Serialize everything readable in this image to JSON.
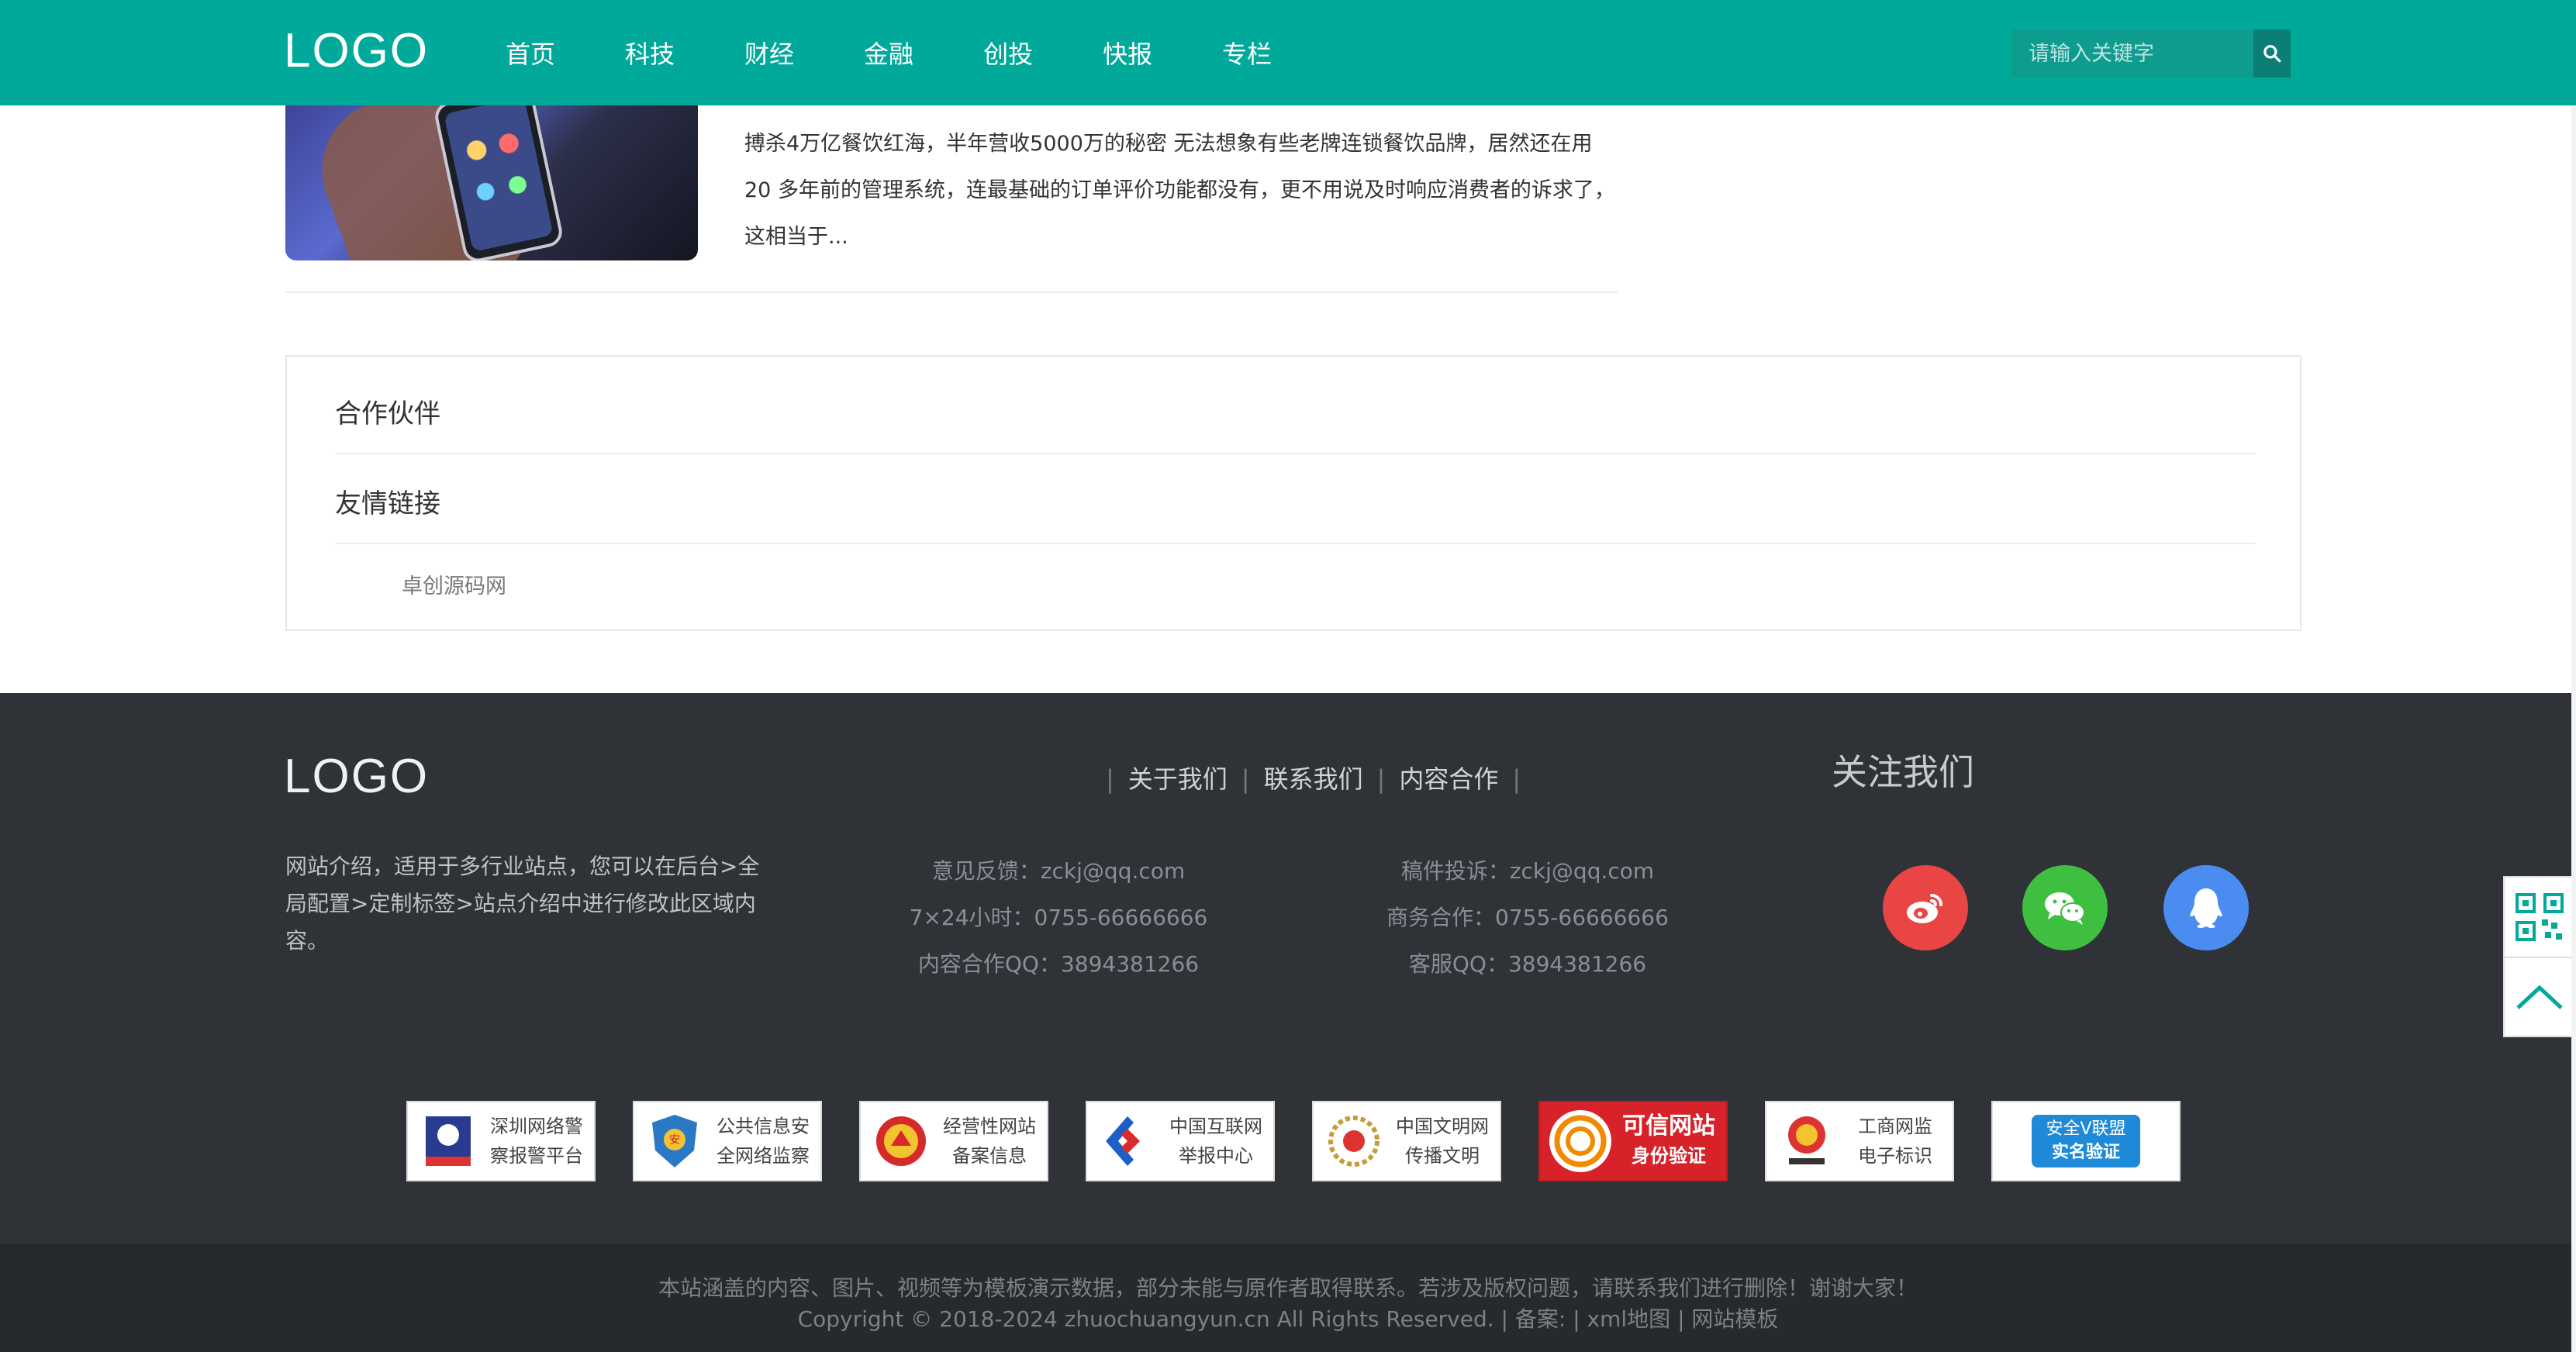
{
  "header": {
    "logo": "LOGO",
    "nav": [
      "首页",
      "科技",
      "财经",
      "金融",
      "创投",
      "快报",
      "专栏"
    ],
    "search_placeholder": "请输入关键字"
  },
  "article": {
    "excerpt": "搏杀4万亿餐饮红海，半年营收5000万的秘密 无法想象有些老牌连锁餐饮品牌，居然还在用20 多年前的管理系统，连最基础的订单评价功能都没有，更不用说及时响应消费者的诉求了，这相当于..."
  },
  "partners": {
    "title": "合作伙伴",
    "links_title": "友情链接",
    "links": [
      "卓创源码网"
    ]
  },
  "footer": {
    "logo": "LOGO",
    "intro": "网站介绍，适用于多行业站点，您可以在后台>全局配置>定制标签>站点介绍中进行修改此区域内容。",
    "links": [
      "关于我们",
      "联系我们",
      "内容合作"
    ],
    "contact_left": [
      "意见反馈：zckj@qq.com",
      "7×24小时：0755-66666666",
      "内容合作QQ：3894381266"
    ],
    "contact_right": [
      "稿件投诉：zckj@qq.com",
      "商务合作：0755-66666666",
      "客服QQ：3894381266"
    ],
    "follow_title": "关注我们",
    "social": [
      {
        "name": "weibo-icon",
        "color": "#e94545"
      },
      {
        "name": "wechat-icon",
        "color": "#3fbf3f"
      },
      {
        "name": "qq-icon",
        "color": "#4a8cf0"
      }
    ],
    "badges": [
      {
        "line1": "深圳网络警",
        "line2": "察报警平台"
      },
      {
        "line1": "公共信息安",
        "line2": "全网络监察"
      },
      {
        "line1": "经营性网站",
        "line2": "备案信息"
      },
      {
        "line1": "中国互联网",
        "line2": "举报中心"
      },
      {
        "line1": "中国文明网",
        "line2": "传播文明"
      },
      {
        "line1": "可信网站",
        "line2": "身份验证"
      },
      {
        "line1": "工商网监",
        "line2": "电子标识"
      },
      {
        "line1": "安全V联盟",
        "line2": "实名验证"
      }
    ]
  },
  "bottom": {
    "notice": "本站涵盖的内容、图片、视频等为模板演示数据，部分未能与原作者取得联系。若涉及版权问题，请联系我们进行删除！谢谢大家！",
    "copyright": "Copyright © 2018-2024 zhuochuangyun.cn All Rights Reserved. | 备案: | xml地图 | 网站模板"
  }
}
